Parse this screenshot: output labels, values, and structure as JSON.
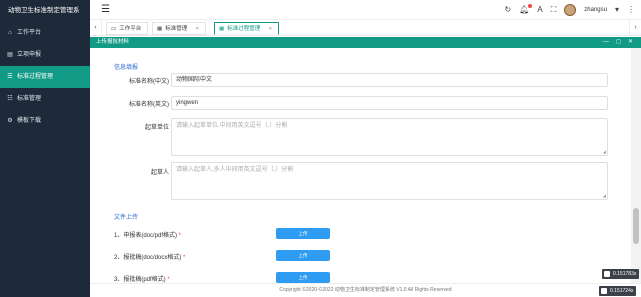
{
  "sidebar": {
    "title": "动物卫生标准制定管理系",
    "items": [
      {
        "icon": "home-icon",
        "glyph": "⌂",
        "label": "工作平台",
        "active": false
      },
      {
        "icon": "file-icon",
        "glyph": "▤",
        "label": "立项申报",
        "active": false
      },
      {
        "icon": "list-icon",
        "glyph": "☰",
        "label": "标准过程管理",
        "active": true
      },
      {
        "icon": "grid-icon",
        "glyph": "☷",
        "label": "标准管理",
        "active": false
      },
      {
        "icon": "settings-icon",
        "glyph": "⚙",
        "label": "模板下载",
        "active": false
      }
    ]
  },
  "header": {
    "menu_icon": "hamburger-icon",
    "username": "zhangsu",
    "icons": [
      "refresh-icon",
      "bell-icon",
      "font-size-icon",
      "fullscreen-icon"
    ]
  },
  "tabs": [
    {
      "icon": "monitor-icon",
      "label": "工作平台",
      "active": false
    },
    {
      "icon": "table-icon",
      "label": "标准管理",
      "active": false
    },
    {
      "icon": "table-icon",
      "label": "标准过程管理",
      "active": true
    }
  ],
  "dialog": {
    "title": "上传报批材料"
  },
  "form": {
    "info_title": "信息填报",
    "fields": {
      "name_cn": {
        "label": "标准名称(中文)",
        "value": "动物国际中文"
      },
      "name_en": {
        "label": "标准名称(英文)",
        "value": "yingwen"
      },
      "drafting_unit": {
        "label": "起草单位",
        "placeholder": "请输入起草单位,中间用英文逗号（,）分割"
      },
      "drafter": {
        "label": "起草人",
        "placeholder": "请输入起草人,多人中间用英文逗号（,）分割"
      }
    },
    "upload_title": "文件上传",
    "uploads": [
      {
        "label": "1、申报表(doc/pdf格式)",
        "button": "上传"
      },
      {
        "label": "2、报批稿(doc/docx格式)",
        "button": "上传"
      },
      {
        "label": "3、报批稿(pdf格式)",
        "button": "上传"
      }
    ]
  },
  "footer": {
    "text": "Copyright ©2020-©2022 动物卫生标准制定管理系统 V1.0 All Rights Reserved"
  },
  "overlays": [
    {
      "text": "0.151783s"
    },
    {
      "text": "0.151724s"
    }
  ],
  "colors": {
    "sidebar_bg": "#1e2a3a",
    "accent": "#119a86",
    "link_blue": "#2f6bd1",
    "button_blue": "#2e9cf3",
    "required": "#e54545"
  }
}
